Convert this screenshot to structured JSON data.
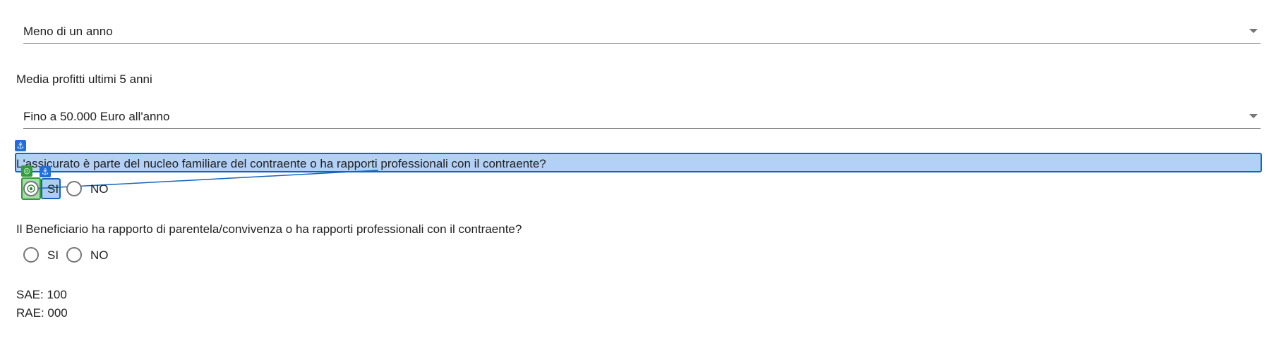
{
  "form": {
    "duration_select": {
      "value": "Meno di un anno"
    },
    "profits": {
      "label": "Media profitti ultimi 5 anni",
      "value": "Fino a 50.000 Euro all'anno"
    },
    "insured_question": {
      "text": "L'assicurato è parte del nucleo familiare del contraente o ha rapporti professionali con il contraente?",
      "options": [
        "SI",
        "NO"
      ]
    },
    "beneficiary_question": {
      "text": "Il Beneficiario ha rapporto di parentela/convivenza o ha rapporti professionali con il contraente?",
      "options": [
        "SI",
        "NO"
      ]
    },
    "sae": "SAE: 100",
    "rae": "RAE: 000"
  },
  "overlay": {
    "anchor_glyph": "⚓",
    "target_glyph": "◎",
    "anchor_color": "#1e6fd9",
    "target_color": "#2e9d3a",
    "icons": [
      "anchor-icon",
      "target-icon"
    ]
  }
}
